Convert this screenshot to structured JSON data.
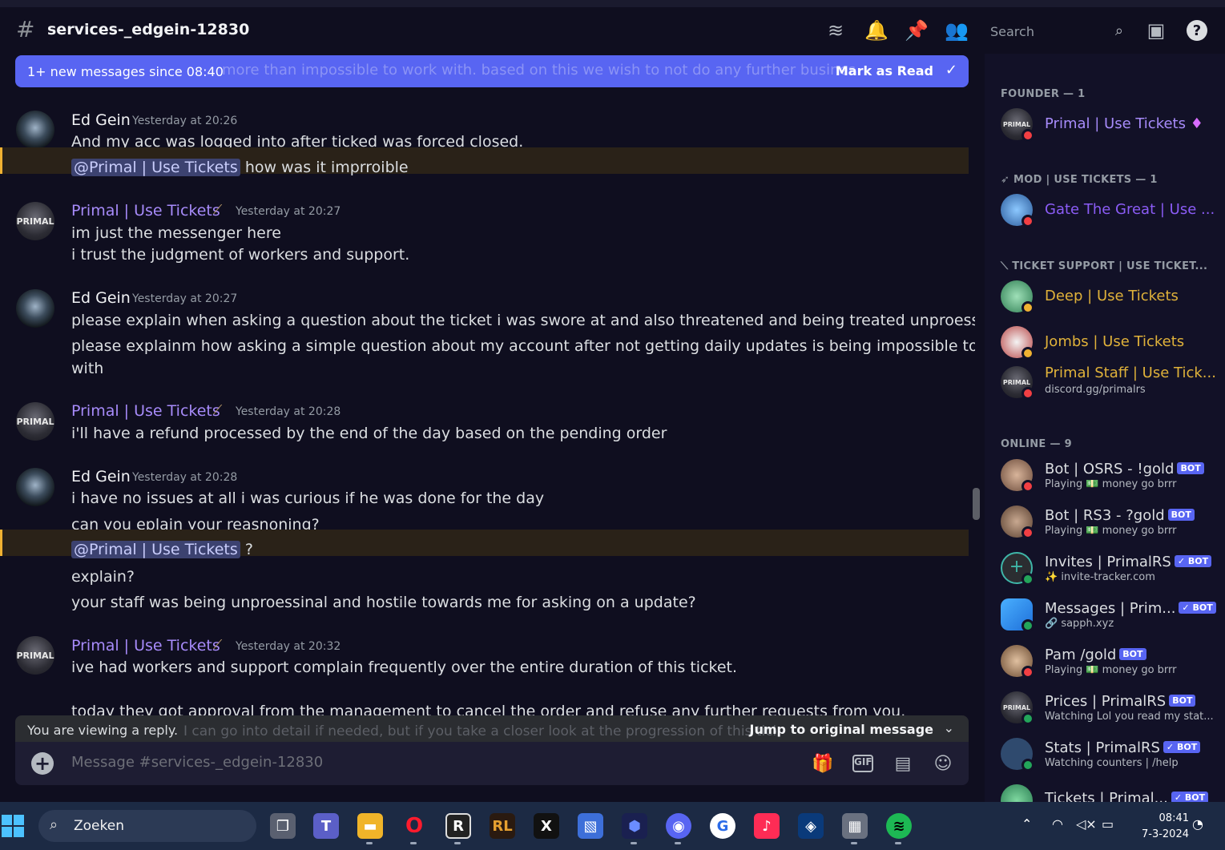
{
  "header": {
    "channel_name": "services-_edgein-12830",
    "search_placeholder": "Search"
  },
  "banner": {
    "text": "1+ new messages since 08:40",
    "ghost_text": "more than impossible to work with. based on this we wish to not do any further business with you",
    "mark_read": "Mark as Read"
  },
  "messages": [
    {
      "author": "Ed Gein",
      "time": "Yesterday at 20:26",
      "lines": [
        "And my acc was logged into after ticked was forced closed."
      ],
      "mention": "@Primal | Use Tickets",
      "mention_text": " how was it imprroible"
    },
    {
      "author": "Primal | Use Tickets",
      "time": "Yesterday at 20:27",
      "lines": [
        "im just the messenger here",
        "i trust the judgment of workers and support."
      ]
    },
    {
      "author": "Ed Gein",
      "time": "Yesterday at 20:27",
      "lines": [
        "please explain when asking a question about the ticket i was swore at and also threatened and being treated unproessinally",
        "please explainm how asking a simple question about my account after not getting daily updates is being impossible to work",
        "with"
      ]
    },
    {
      "author": "Primal | Use Tickets",
      "time": "Yesterday at 20:28",
      "lines": [
        "i'll have a refund processed by the end of the day based on the pending order"
      ]
    },
    {
      "author": "Ed Gein",
      "time": "Yesterday at 20:28",
      "lines": [
        "i have no issues at all i was curious if he was done for the day",
        "can you eplain your reasnoning?"
      ],
      "mention": "@Primal | Use Tickets",
      "mention_text": " ?",
      "after": [
        "explain?",
        "your staff was being unproessinal and hostile towards me for asking on a update?"
      ]
    },
    {
      "author": "Primal | Use Tickets",
      "time": "Yesterday at 20:32",
      "lines": [
        "ive had workers and support complain frequently over the entire duration of this ticket.",
        "today they got approval from the management to cancel the order and refuse any further requests from you."
      ]
    }
  ],
  "reply_bar": {
    "text": "You are viewing a reply.",
    "ghost": "I can go into detail if needed, but if you take a closer look at the progression of this ticket i think it speaks for itself",
    "jump": "Jump to original message"
  },
  "composer": {
    "placeholder": "Message #services-_edgein-12830"
  },
  "members": {
    "categories": {
      "founder": "FOUNDER — 1",
      "mod": "MOD | USE TICKETS — 1",
      "support": "TICKET SUPPORT | USE TICKET...",
      "online": "ONLINE — 9"
    },
    "founder": [
      {
        "name": "Primal | Use Tickets",
        "color": "#a78bfa"
      }
    ],
    "mod": [
      {
        "name": "Gate The Great | Use ...",
        "color": "#8b5cf6"
      }
    ],
    "support": [
      {
        "name": "Deep | Use Tickets",
        "color": "#e0b23a"
      },
      {
        "name": "Jombs | Use Tickets",
        "color": "#e0b23a"
      },
      {
        "name": "Primal Staff | Use Tick...",
        "color": "#e0b23a",
        "sub": "discord.gg/primalrs"
      }
    ],
    "online": [
      {
        "name": "Bot | OSRS - !gold",
        "sub": "Playing 💵 money go brrr",
        "bot": "BOT",
        "status": "dnd"
      },
      {
        "name": "Bot | RS3 - ?gold",
        "sub": "Playing 💵 money go brrr",
        "bot": "BOT",
        "status": "dnd"
      },
      {
        "name": "Invites | PrimalRS",
        "sub": "✨ invite-tracker.com",
        "bot": "✓ BOT",
        "status": "on"
      },
      {
        "name": "Messages | Prim...",
        "sub": "🔗 sapph.xyz",
        "bot": "✓ BOT",
        "status": "on"
      },
      {
        "name": "Pam /gold",
        "sub": "Playing 💵 money go brrr",
        "bot": "BOT",
        "status": "dnd"
      },
      {
        "name": "Prices | PrimalRS",
        "sub": "Watching Lol you read my stat...",
        "bot": "BOT",
        "status": "on"
      },
      {
        "name": "Stats | PrimalRS",
        "sub": "Watching counters | /help",
        "bot": "✓ BOT",
        "status": "on"
      },
      {
        "name": "Tickets | Primal...",
        "sub": "",
        "bot": "✓ BOT",
        "status": "on"
      }
    ]
  },
  "taskbar": {
    "search": "Zoeken",
    "time": "08:41",
    "date": "7-3-2024"
  },
  "colors": {
    "accent": "#5865f2",
    "mention_bg": "#2a2218",
    "dnd": "#f23f43",
    "online": "#23a55a"
  }
}
